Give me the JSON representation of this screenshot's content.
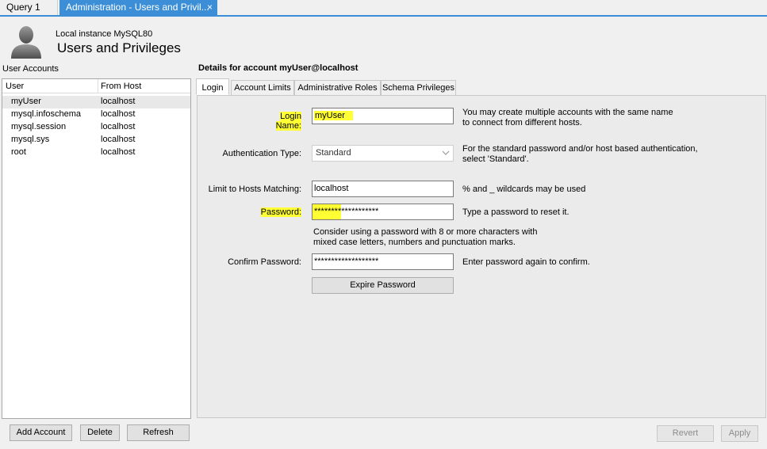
{
  "tabs": {
    "query": "Query 1",
    "admin": "Administration - Users and Privil...",
    "close": "×"
  },
  "header": {
    "instance": "Local instance MySQL80",
    "title": "Users and Privileges"
  },
  "user_accounts": {
    "label": "User Accounts",
    "col_user": "User",
    "col_host": "From Host",
    "rows": [
      {
        "user": "myUser",
        "host": "localhost"
      },
      {
        "user": "mysql.infoschema",
        "host": "localhost"
      },
      {
        "user": "mysql.session",
        "host": "localhost"
      },
      {
        "user": "mysql.sys",
        "host": "localhost"
      },
      {
        "user": "root",
        "host": "localhost"
      }
    ],
    "add": "Add Account",
    "delete": "Delete",
    "refresh": "Refresh"
  },
  "details": {
    "title": "Details for account myUser@localhost",
    "tabs": [
      "Login",
      "Account Limits",
      "Administrative Roles",
      "Schema Privileges"
    ],
    "login_name_label": "Login Name:",
    "login_name_value": "myUser",
    "login_name_hint1": "You may create multiple accounts with the same name",
    "login_name_hint2": "to connect from different hosts.",
    "auth_label": "Authentication Type:",
    "auth_value": "Standard",
    "auth_hint1": "For the standard password and/or host based authentication,",
    "auth_hint2": "select 'Standard'.",
    "hosts_label": "Limit to Hosts Matching:",
    "hosts_value": "localhost",
    "hosts_hint": "% and _ wildcards may be used",
    "password_label": "Password:",
    "password_value": "*******************",
    "password_hint": "Type a password to reset it.",
    "password_advice1": "Consider using a password with 8 or more characters with",
    "password_advice2": "mixed case letters, numbers and punctuation marks.",
    "confirm_label": "Confirm Password:",
    "confirm_value": "*******************",
    "confirm_hint": "Enter password again to confirm.",
    "expire_button": "Expire Password",
    "revert": "Revert",
    "apply": "Apply"
  },
  "colors": {
    "accent": "#3c8fd6",
    "highlight": "#ffff33"
  },
  "icons": {
    "avatar": "user-avatar-icon",
    "close": "close-icon",
    "dropdown": "chevron-down-icon"
  }
}
